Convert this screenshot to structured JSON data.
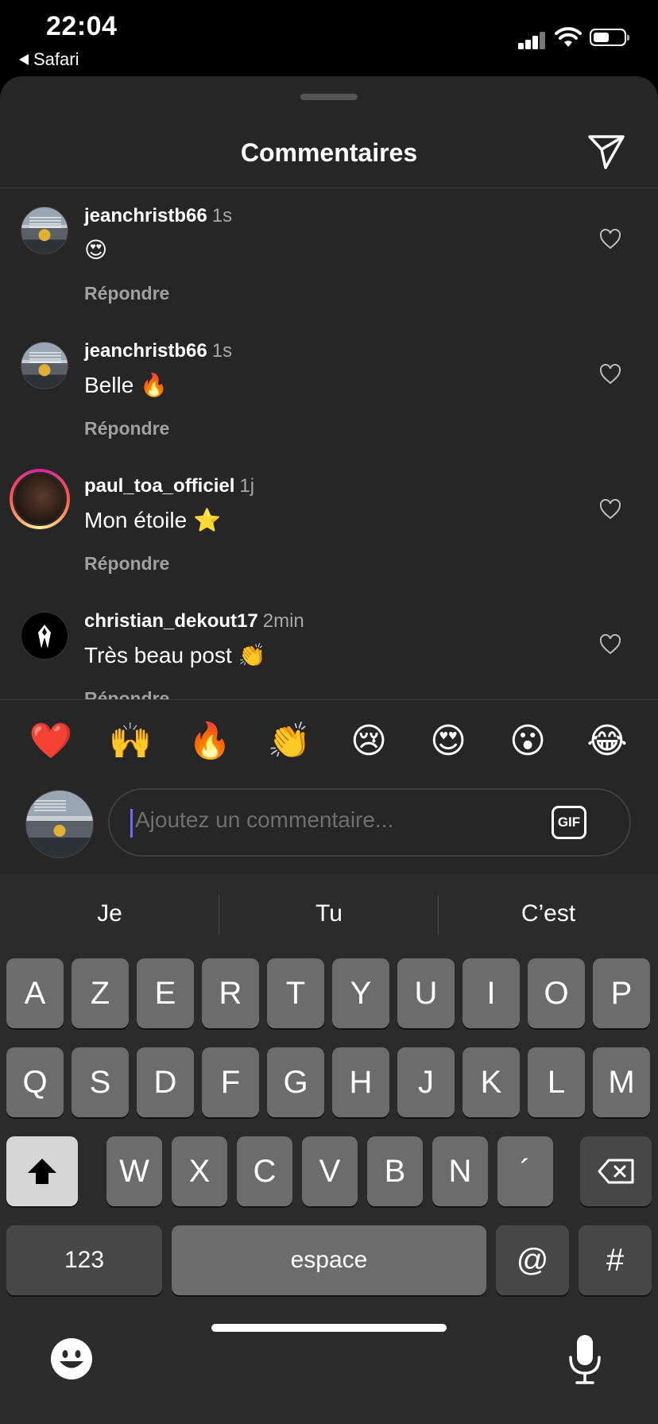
{
  "status_bar": {
    "time": "22:04",
    "back_app": "Safari"
  },
  "sheet": {
    "title": "Commentaires"
  },
  "comments": [
    {
      "username": "jeanchristb66",
      "time": "1s",
      "text": "😍",
      "reply": "Répondre"
    },
    {
      "username": "jeanchristb66",
      "time": "1s",
      "text": "Belle 🔥",
      "reply": "Répondre"
    },
    {
      "username": "paul_toa_officiel",
      "time": "1j",
      "text": "Mon étoile ⭐️",
      "reply": "Répondre"
    },
    {
      "username": "christian_dekout17",
      "time": "2min",
      "text": "Très beau post 👏",
      "reply": "Répondre"
    }
  ],
  "emoji_bar": [
    "❤️",
    "🙌",
    "🔥",
    "👏",
    "😢",
    "😍",
    "😮",
    "😂"
  ],
  "composer": {
    "placeholder": "Ajoutez un commentaire...",
    "gif_label": "GIF"
  },
  "keyboard": {
    "predictions": [
      "Je",
      "Tu",
      "C’est"
    ],
    "row1": [
      "A",
      "Z",
      "E",
      "R",
      "T",
      "Y",
      "U",
      "I",
      "O",
      "P"
    ],
    "row2": [
      "Q",
      "S",
      "D",
      "F",
      "G",
      "H",
      "J",
      "K",
      "L",
      "M"
    ],
    "row3": [
      "W",
      "X",
      "C",
      "V",
      "B",
      "N",
      "´"
    ],
    "numbers_label": "123",
    "space_label": "espace",
    "at_label": "@",
    "hash_label": "#"
  },
  "colors": {
    "sheet_bg": "#262626",
    "keyboard_bg": "#2b2b2b",
    "key": "#6c6c6c",
    "caret": "#6b6bff"
  }
}
